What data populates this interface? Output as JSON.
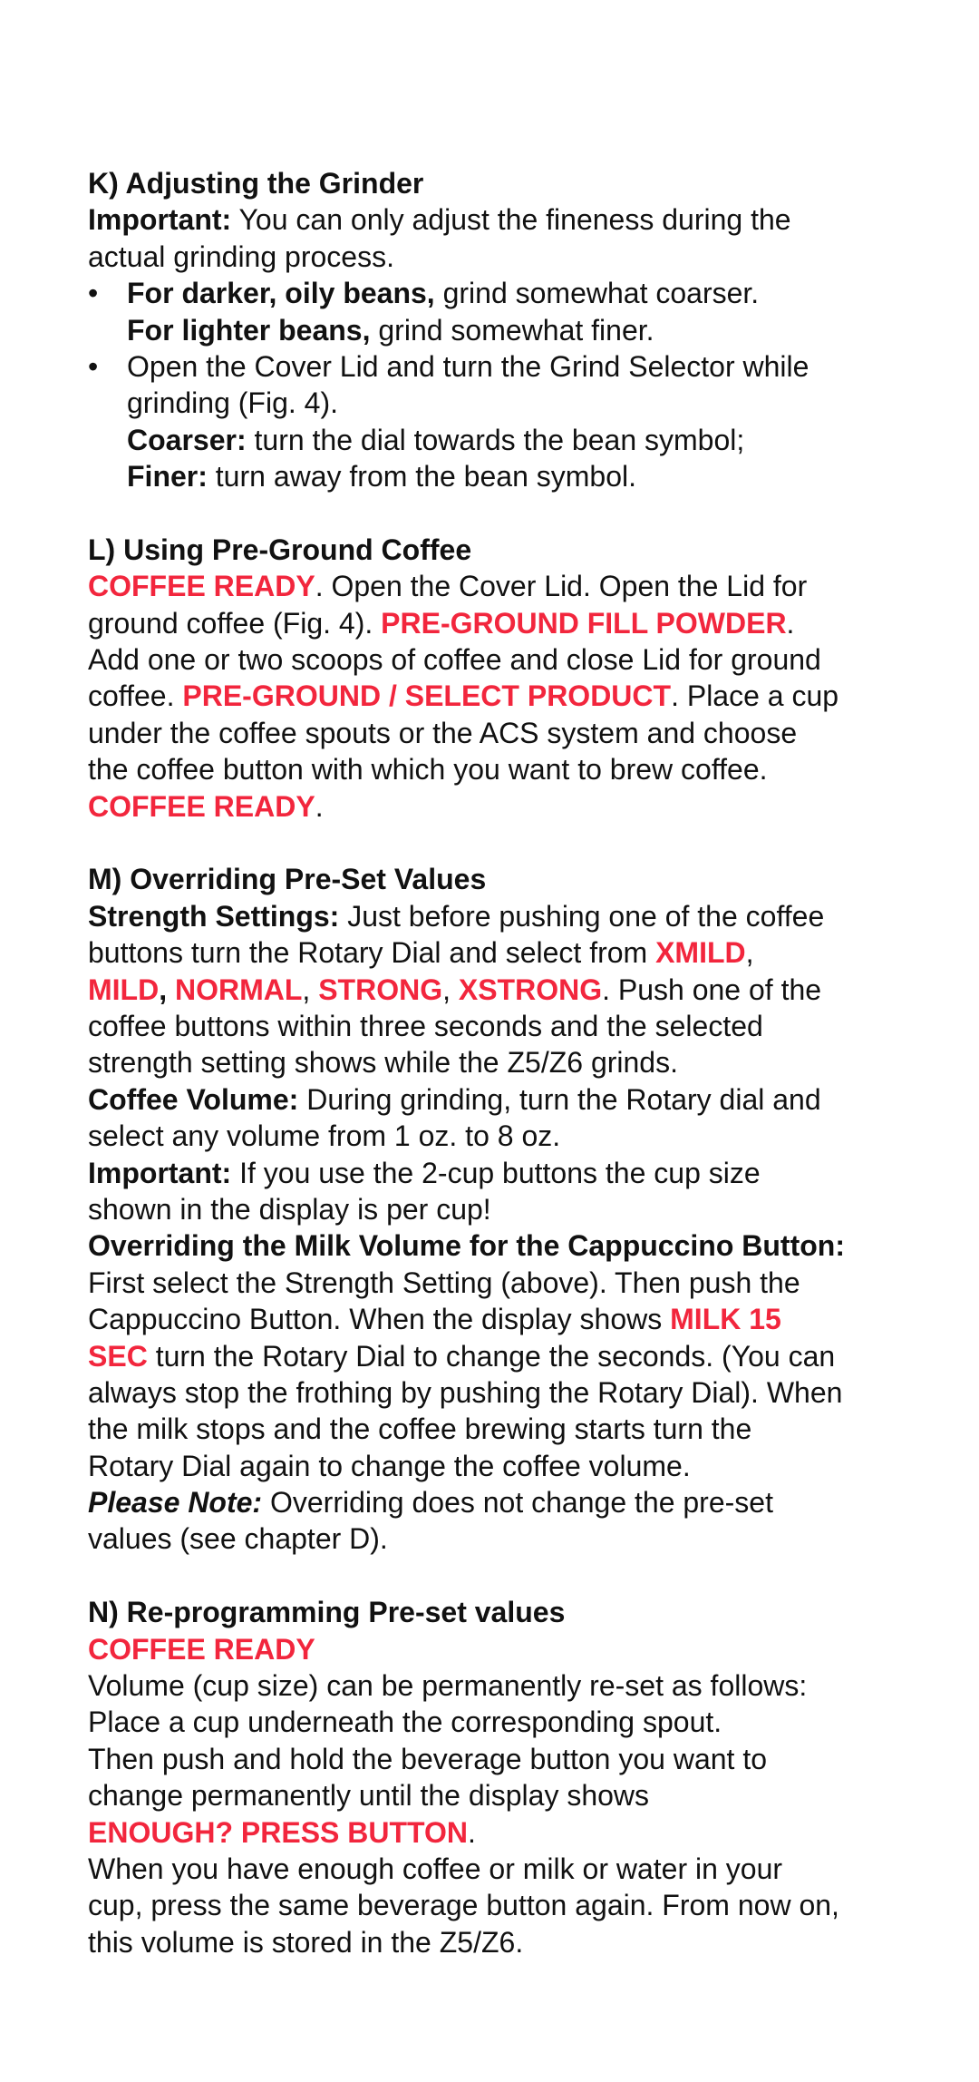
{
  "colors": {
    "text": "#111111",
    "highlight": "#f2263d",
    "background": "#ffffff"
  },
  "sections": [
    {
      "id": "k",
      "lines": [
        {
          "segs": [
            [
              "b",
              "K) Adjusting the Grinder"
            ]
          ]
        },
        {
          "segs": [
            [
              "b",
              "Important:"
            ],
            [
              "n",
              " You can only adjust the fineness during the"
            ]
          ]
        },
        {
          "segs": [
            [
              "n",
              "actual grinding process."
            ]
          ]
        },
        {
          "bullet": true,
          "segs": [
            [
              "b",
              "For darker, oily beans,"
            ],
            [
              "n",
              " grind somewhat coarser."
            ]
          ]
        },
        {
          "indent": true,
          "segs": [
            [
              "b",
              "For lighter beans,"
            ],
            [
              "n",
              " grind somewhat finer."
            ]
          ]
        },
        {
          "bullet": true,
          "segs": [
            [
              "n",
              "Open the Cover Lid and turn the Grind Selector while"
            ]
          ]
        },
        {
          "indent": true,
          "segs": [
            [
              "n",
              "grinding (Fig. 4)."
            ]
          ]
        },
        {
          "indent": true,
          "segs": [
            [
              "b",
              "Coarser:"
            ],
            [
              "n",
              " turn the dial towards the bean symbol;"
            ]
          ]
        },
        {
          "indent": true,
          "segs": [
            [
              "b",
              "Finer:"
            ],
            [
              "n",
              " turn away from the bean symbol."
            ]
          ]
        }
      ]
    },
    {
      "id": "l",
      "lines": [
        {
          "segs": [
            [
              "b",
              "L) Using Pre-Ground Coffee"
            ]
          ]
        },
        {
          "segs": [
            [
              "r",
              "COFFEE READY"
            ],
            [
              "n",
              ". Open the Cover Lid. Open the Lid for"
            ]
          ]
        },
        {
          "segs": [
            [
              "n",
              "ground coffee (Fig. 4). "
            ],
            [
              "r",
              "PRE-GROUND FILL POWDER"
            ],
            [
              "n",
              "."
            ]
          ]
        },
        {
          "segs": [
            [
              "n",
              "Add one or two scoops of coffee and close Lid for ground"
            ]
          ]
        },
        {
          "segs": [
            [
              "n",
              "coffee. "
            ],
            [
              "r",
              "PRE-GROUND / SELECT PRODUCT"
            ],
            [
              "n",
              ". Place a cup"
            ]
          ]
        },
        {
          "segs": [
            [
              "n",
              "under the coffee spouts or the ACS system and choose"
            ]
          ]
        },
        {
          "segs": [
            [
              "n",
              "the coffee button with which you want to brew coffee."
            ]
          ]
        },
        {
          "segs": [
            [
              "r",
              "COFFEE READY"
            ],
            [
              "n",
              "."
            ]
          ]
        }
      ]
    },
    {
      "id": "m",
      "lines": [
        {
          "segs": [
            [
              "b",
              "M) Overriding Pre-Set Values"
            ]
          ]
        },
        {
          "segs": [
            [
              "b",
              "Strength Settings:"
            ],
            [
              "n",
              " Just before pushing one of the coffee"
            ]
          ]
        },
        {
          "segs": [
            [
              "n",
              "buttons turn the Rotary Dial and select from "
            ],
            [
              "r",
              "XMILD"
            ],
            [
              "n",
              ","
            ]
          ]
        },
        {
          "segs": [
            [
              "r",
              "MILD"
            ],
            [
              "b",
              ","
            ],
            [
              "n",
              " "
            ],
            [
              "r",
              "NORMAL"
            ],
            [
              "n",
              ", "
            ],
            [
              "r",
              "STRONG"
            ],
            [
              "n",
              ", "
            ],
            [
              "r",
              "XSTRONG"
            ],
            [
              "n",
              ". Push one of the"
            ]
          ]
        },
        {
          "segs": [
            [
              "n",
              "coffee buttons within three seconds and the selected"
            ]
          ]
        },
        {
          "segs": [
            [
              "n",
              "strength setting shows while the Z5/Z6 grinds."
            ]
          ]
        },
        {
          "segs": [
            [
              "b",
              "Coffee Volume:"
            ],
            [
              "n",
              " During grinding, turn the Rotary dial and"
            ]
          ]
        },
        {
          "segs": [
            [
              "n",
              "select any volume from 1 oz. to 8 oz."
            ]
          ]
        },
        {
          "segs": [
            [
              "b",
              "Important:"
            ],
            [
              "n",
              " If you use the 2-cup buttons the cup size"
            ]
          ]
        },
        {
          "segs": [
            [
              "n",
              "shown in the display is per cup!"
            ]
          ]
        },
        {
          "segs": [
            [
              "b",
              "Overriding the Milk Volume for the Cappuccino Button:"
            ]
          ]
        },
        {
          "segs": [
            [
              "n",
              "First select the Strength Setting (above). Then push the"
            ]
          ]
        },
        {
          "segs": [
            [
              "n",
              "Cappuccino Button. When the display shows "
            ],
            [
              "r",
              "MILK 15"
            ]
          ]
        },
        {
          "segs": [
            [
              "r",
              "SEC"
            ],
            [
              "n",
              " turn the Rotary Dial to change the seconds. (You can"
            ]
          ]
        },
        {
          "segs": [
            [
              "n",
              "always stop the frothing by pushing the Rotary Dial). When"
            ]
          ]
        },
        {
          "segs": [
            [
              "n",
              "the milk stops and the coffee brewing starts turn the"
            ]
          ]
        },
        {
          "segs": [
            [
              "n",
              "Rotary Dial again to change the coffee volume."
            ]
          ]
        },
        {
          "segs": [
            [
              "i",
              "Please Note:"
            ],
            [
              "n",
              " Overriding does not change the pre-set"
            ]
          ]
        },
        {
          "segs": [
            [
              "n",
              "values (see chapter D)."
            ]
          ]
        }
      ]
    },
    {
      "id": "n",
      "lines": [
        {
          "segs": [
            [
              "b",
              "N) Re-programming Pre-set values"
            ]
          ]
        },
        {
          "segs": [
            [
              "r",
              "COFFEE READY"
            ]
          ]
        },
        {
          "segs": [
            [
              "n",
              "Volume (cup size) can be permanently re-set as follows:"
            ]
          ]
        },
        {
          "segs": [
            [
              "n",
              "Place a cup underneath the corresponding spout."
            ]
          ]
        },
        {
          "segs": [
            [
              "n",
              "Then push and hold the beverage button you want to"
            ]
          ]
        },
        {
          "segs": [
            [
              "n",
              "change permanently until the display shows"
            ]
          ]
        },
        {
          "segs": [
            [
              "r",
              "ENOUGH? PRESS BUTTON"
            ],
            [
              "n",
              "."
            ]
          ]
        },
        {
          "segs": [
            [
              "n",
              "When you have enough coffee or milk or water in your"
            ]
          ]
        },
        {
          "segs": [
            [
              "n",
              "cup, press the same beverage button again. From now on,"
            ]
          ]
        },
        {
          "segs": [
            [
              "n",
              "this volume is stored in the Z5/Z6."
            ]
          ]
        }
      ]
    }
  ],
  "bullet_glyph": "•"
}
